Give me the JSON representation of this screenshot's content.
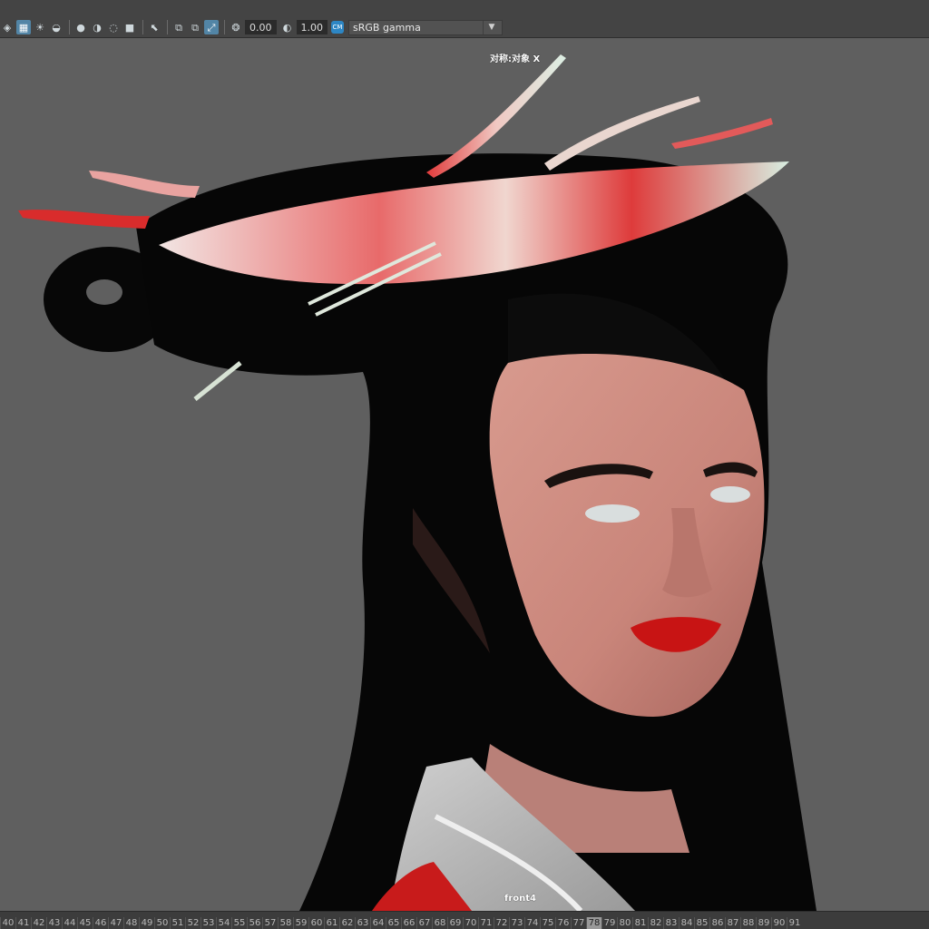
{
  "toolbar": {
    "icons": [
      "cube-icon",
      "checker-icon",
      "light-icon",
      "teapot-icon",
      "sphere-icon",
      "shadow-sphere-icon",
      "ring-icon",
      "display-icon",
      "select-icon",
      "copy-icon",
      "paste-icon",
      "frame-icon",
      "aperture-icon",
      "exposure-icon"
    ],
    "exposure_value": "0.00",
    "gamma_value": "1.00",
    "colorspace": "sRGB gamma",
    "colormanage_badge": "CM"
  },
  "viewport": {
    "object_label": "对称:对象 X",
    "camera_label": "front4"
  },
  "timeline": {
    "frames": [
      "40",
      "41",
      "42",
      "43",
      "44",
      "45",
      "46",
      "47",
      "48",
      "49",
      "50",
      "51",
      "52",
      "53",
      "54",
      "55",
      "56",
      "57",
      "58",
      "59",
      "60",
      "61",
      "62",
      "63",
      "64",
      "65",
      "66",
      "67",
      "68",
      "69",
      "70",
      "71",
      "72",
      "73",
      "74",
      "75",
      "76",
      "77",
      "78",
      "79",
      "80",
      "81",
      "82",
      "83",
      "84",
      "85",
      "86",
      "87",
      "88",
      "89",
      "90",
      "91"
    ],
    "current_frame": "78"
  }
}
